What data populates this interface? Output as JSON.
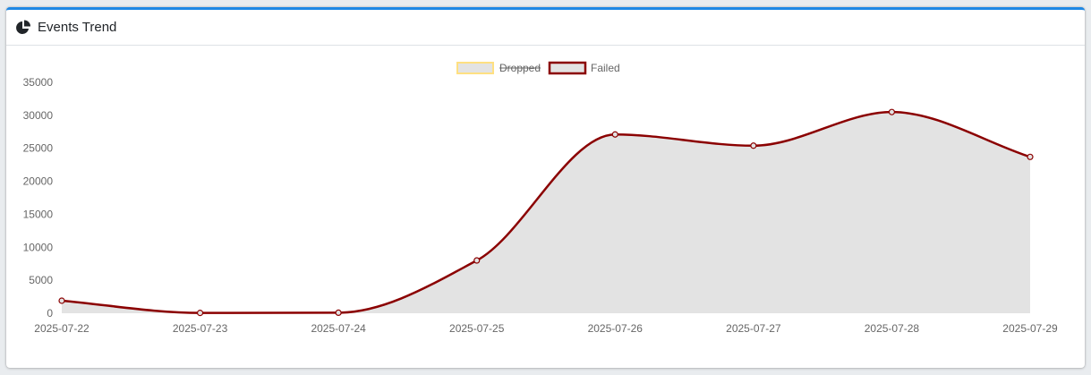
{
  "header": {
    "title": "Events Trend",
    "icon": "pie-chart-icon"
  },
  "colors": {
    "card_accent": "#1e88e5",
    "failed_line": "#8b0000",
    "failed_fill": "#e3e3e3",
    "dropped_border": "#ffe082",
    "dropped_fill": "#e3e3e3"
  },
  "chart_data": {
    "type": "area",
    "x": [
      "2025-07-22",
      "2025-07-23",
      "2025-07-24",
      "2025-07-25",
      "2025-07-26",
      "2025-07-27",
      "2025-07-28",
      "2025-07-29"
    ],
    "series": [
      {
        "name": "Dropped",
        "hidden": true,
        "values": []
      },
      {
        "name": "Failed",
        "hidden": false,
        "values": [
          1900,
          50,
          80,
          8000,
          27100,
          25400,
          30500,
          23700
        ]
      }
    ],
    "yticks": [
      "0",
      "5000",
      "10000",
      "15000",
      "20000",
      "25000",
      "30000",
      "35000"
    ],
    "ylim": [
      0,
      35000
    ],
    "legend_position": "top",
    "grid": false
  }
}
